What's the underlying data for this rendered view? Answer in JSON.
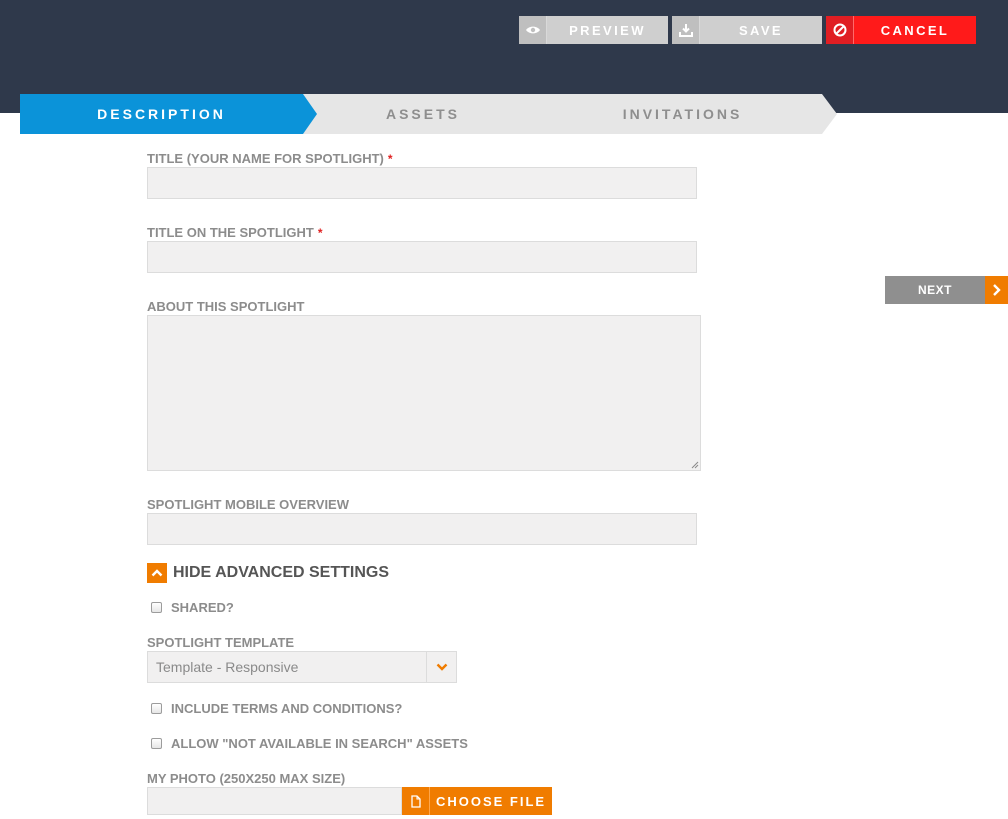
{
  "toolbar": {
    "preview": {
      "label": "PREVIEW",
      "icon": "eye-icon"
    },
    "save": {
      "label": "SAVE",
      "icon": "download-icon"
    },
    "cancel": {
      "label": "CANCEL",
      "icon": "cancel-icon"
    }
  },
  "steps": [
    {
      "label": "DESCRIPTION",
      "active": true
    },
    {
      "label": "ASSETS",
      "active": false
    },
    {
      "label": "INVITATIONS",
      "active": false
    }
  ],
  "form": {
    "title": {
      "label": "TITLE (YOUR NAME FOR SPOTLIGHT)",
      "required_mark": "*",
      "value": ""
    },
    "title_on_spotlight": {
      "label": "TITLE ON THE SPOTLIGHT",
      "required_mark": "*",
      "value": ""
    },
    "about": {
      "label": "ABOUT THIS SPOTLIGHT",
      "value": ""
    },
    "mobile_overview": {
      "label": "SPOTLIGHT MOBILE OVERVIEW",
      "value": ""
    },
    "advanced_toggle": {
      "label": "HIDE ADVANCED SETTINGS",
      "icon": "chevron-up-icon"
    },
    "shared": {
      "label": "SHARED?",
      "checked": false
    },
    "template": {
      "label": "SPOTLIGHT TEMPLATE",
      "selected": "Template - Responsive",
      "icon": "chevron-down-icon"
    },
    "terms": {
      "label": "INCLUDE TERMS AND CONDITIONS?",
      "checked": false
    },
    "not_available": {
      "label": "ALLOW \"NOT AVAILABLE IN SEARCH\" ASSETS",
      "checked": false
    },
    "photo": {
      "label": "MY PHOTO (250X250 MAX SIZE)",
      "button_label": "CHOOSE FILE",
      "icon": "file-icon",
      "value": ""
    }
  },
  "next": {
    "label": "NEXT",
    "icon": "chevron-right-icon"
  },
  "colors": {
    "header_bg": "#2f394b",
    "active_step": "#0b93d9",
    "accent_orange": "#f07c00",
    "cancel_red": "#ff1a1a",
    "label_gray": "#8c8c8c"
  }
}
